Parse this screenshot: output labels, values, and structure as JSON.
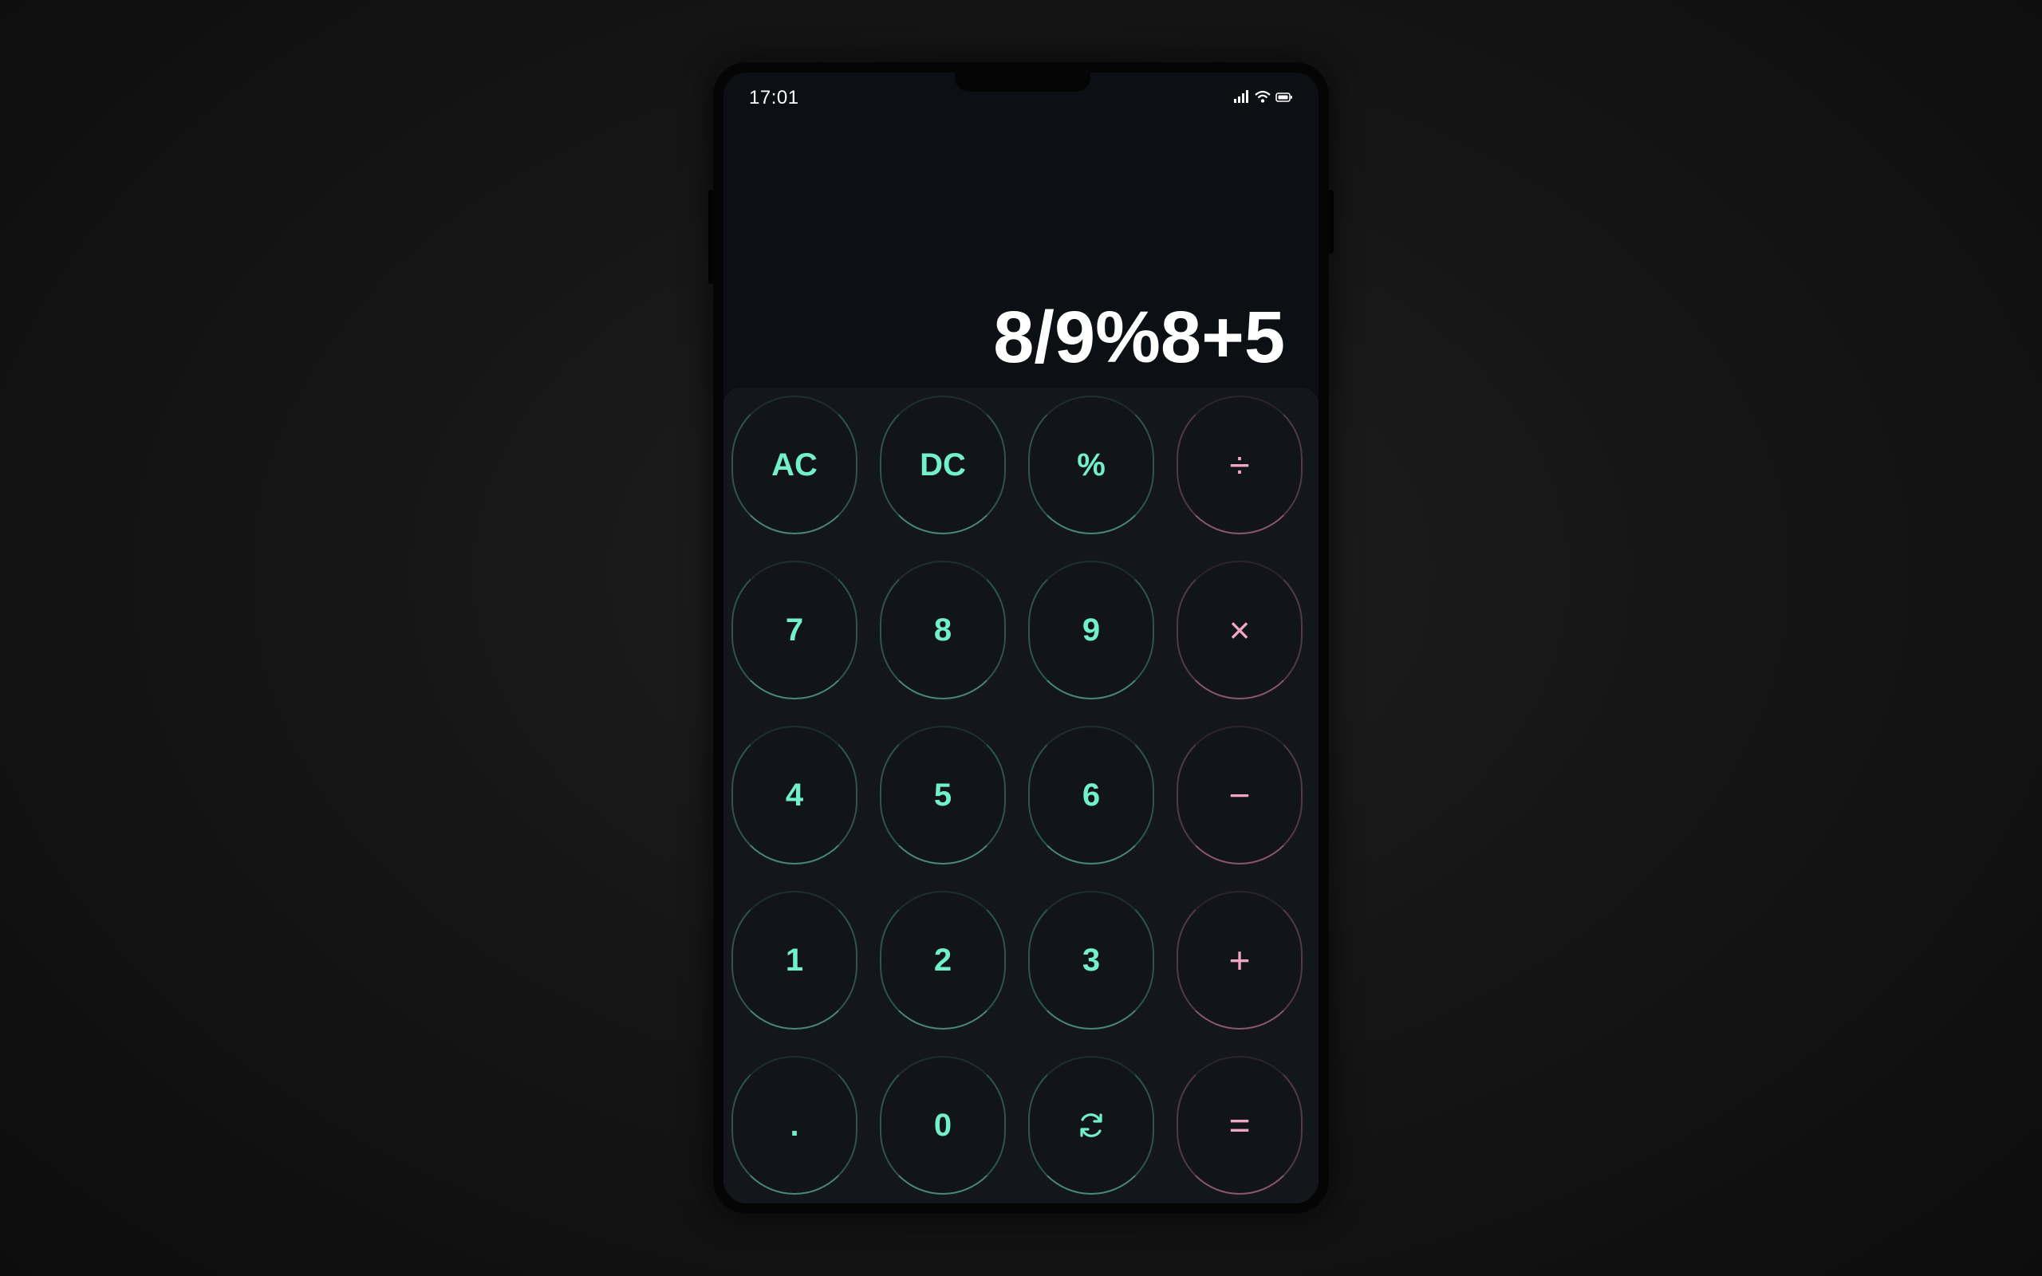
{
  "status": {
    "time": "17:01",
    "icons": [
      "signal-icon",
      "wifi-icon",
      "battery-icon"
    ]
  },
  "display": {
    "expression": "8/9%8+5"
  },
  "colors": {
    "digit": "#72f0cc",
    "operator": "#f2a6c6",
    "background": "#0c0f13",
    "keypad": "#13171b"
  },
  "keys": {
    "ac": "AC",
    "dc": "DC",
    "percent": "%",
    "divide": "÷",
    "seven": "7",
    "eight": "8",
    "nine": "9",
    "multiply": "×",
    "four": "4",
    "five": "5",
    "six": "6",
    "minus": "−",
    "one": "1",
    "two": "2",
    "three": "3",
    "plus": "+",
    "decimal": ".",
    "zero": "0",
    "refresh_icon": "refresh-icon",
    "equals": "="
  }
}
